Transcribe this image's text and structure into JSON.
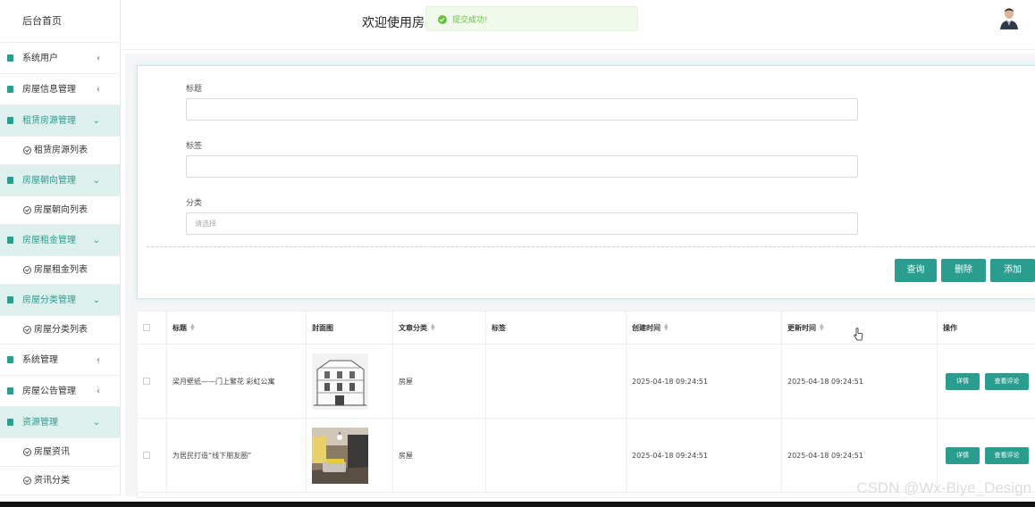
{
  "sidebar": {
    "home": "后台首页",
    "items": [
      {
        "label": "系统用户",
        "type": "collapsed"
      },
      {
        "label": "房屋信息管理",
        "type": "collapsed"
      },
      {
        "label": "租赁房源管理",
        "type": "open",
        "sub": "租赁房源列表"
      },
      {
        "label": "房屋朝向管理",
        "type": "open",
        "sub": "房屋朝向列表"
      },
      {
        "label": "房屋租金管理",
        "type": "open",
        "sub": "房屋租金列表"
      },
      {
        "label": "房屋分类管理",
        "type": "open",
        "sub": "房屋分类列表"
      },
      {
        "label": "系统管理",
        "type": "collapsed"
      },
      {
        "label": "房屋公告管理",
        "type": "collapsed"
      },
      {
        "label": "资源管理",
        "type": "open",
        "subs": [
          "房屋资讯",
          "资讯分类"
        ]
      }
    ]
  },
  "header": {
    "welcome": "欢迎使用房",
    "toast": "提交成功!"
  },
  "search": {
    "title_label": "标题",
    "tag_label": "标签",
    "category_label": "分类",
    "category_placeholder": "请选择",
    "query_btn": "查询",
    "delete_btn": "删除",
    "add_btn": "添加"
  },
  "table": {
    "headers": [
      "标题",
      "封面图",
      "文章分类",
      "标签",
      "创建时间",
      "更新时间",
      "操作"
    ],
    "rows": [
      {
        "title": "梁月壁纸——门上繁花 彩虹公寓",
        "category": "房屋",
        "tag": "",
        "created": "2025-04-18 09:24:51",
        "updated": "2025-04-18 09:24:51"
      },
      {
        "title": "为居民打造“线下朋友圈”",
        "category": "房屋",
        "tag": "",
        "created": "2025-04-18 09:24:51",
        "updated": "2025-04-18 09:24:51"
      }
    ],
    "detail_btn": "详情",
    "comment_btn": "查看评论"
  },
  "watermark": "CSDN @Wx-Biye_Design",
  "colors": {
    "accent": "#2a9d8f",
    "success": "#67c23a"
  }
}
